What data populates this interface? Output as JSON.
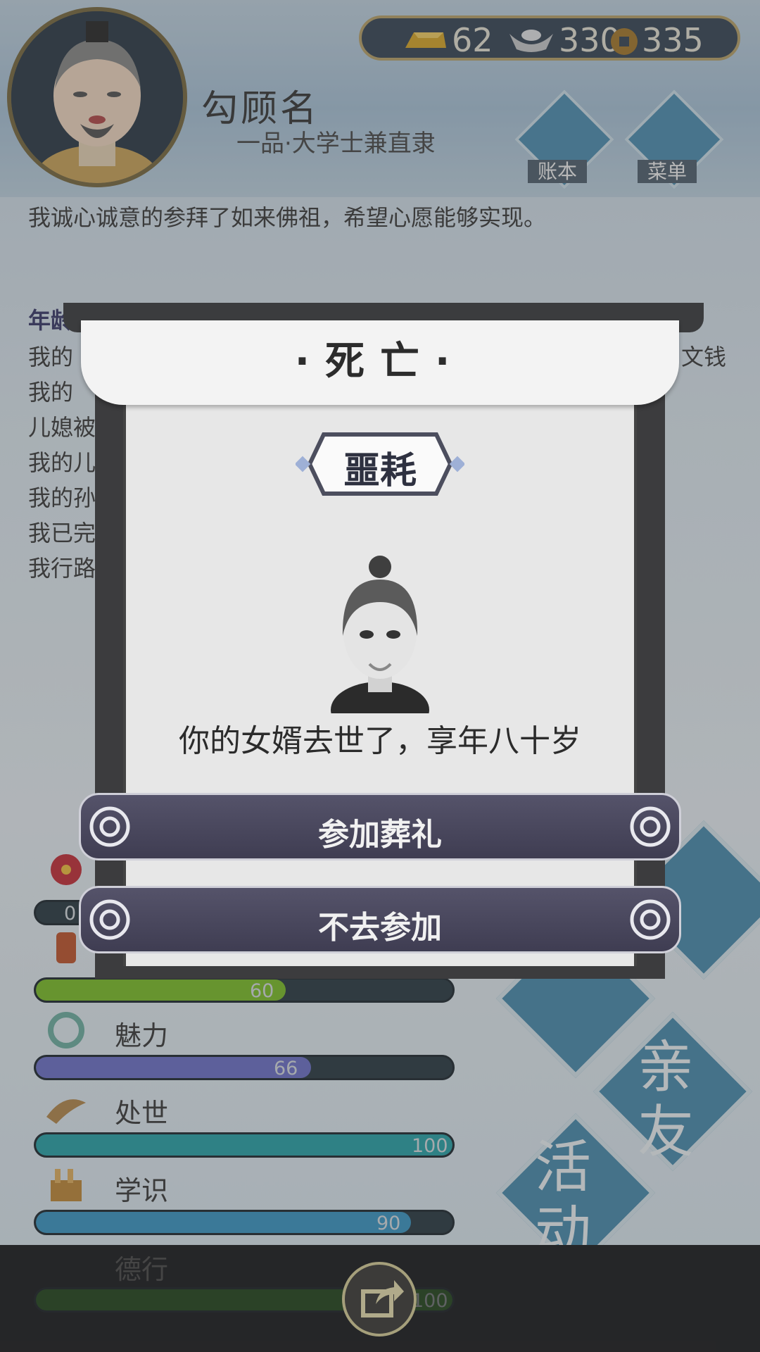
{
  "header": {
    "name": "勾顾名",
    "rank": "一品·大学士兼直隶",
    "currency": {
      "gold": "62",
      "silver": "330",
      "coins": "335"
    },
    "buttons": {
      "ledger": "账本",
      "menu": "菜单"
    }
  },
  "log": {
    "first_line": "我诚心诚意的参拜了如来佛祖，希望心愿能够实现。",
    "age_label": "年龄",
    "fragments": [
      "我的",
      "我的",
      "儿媳被",
      "我的儿",
      "我的孙",
      "我已完",
      "我行路"
    ],
    "right_fragment": "文钱"
  },
  "stats": [
    {
      "label": "",
      "value": "0",
      "percent": 0,
      "color": "#2b2b2b"
    },
    {
      "label": "",
      "value": "60",
      "percent": 60,
      "color": "#7cbf2a"
    },
    {
      "label": "魅力",
      "value": "66",
      "percent": 66,
      "color": "#6d72c9"
    },
    {
      "label": "处世",
      "value": "100",
      "percent": 100,
      "color": "#2aa3a8"
    },
    {
      "label": "学识",
      "value": "90",
      "percent": 90,
      "color": "#3b97c4"
    },
    {
      "label": "德行",
      "value": "100",
      "percent": 100,
      "color": "#2f7a1e"
    }
  ],
  "side_buttons": {
    "family": "亲友",
    "activity": "活动"
  },
  "dialog": {
    "title": "·死亡·",
    "badge": "噩耗",
    "message": "你的女婿去世了，享年八十岁",
    "attend_button": "参加葬礼",
    "decline_button": "不去参加"
  },
  "colors": {
    "dialog_button": "#45435a",
    "currency_border": "#b8a36a",
    "accent_blue": "#4b8daf"
  },
  "icons": [
    "gold-ingot-icon",
    "silver-ingot-icon",
    "copper-coin-icon",
    "ledger-icon",
    "menu-icon",
    "share-icon"
  ]
}
